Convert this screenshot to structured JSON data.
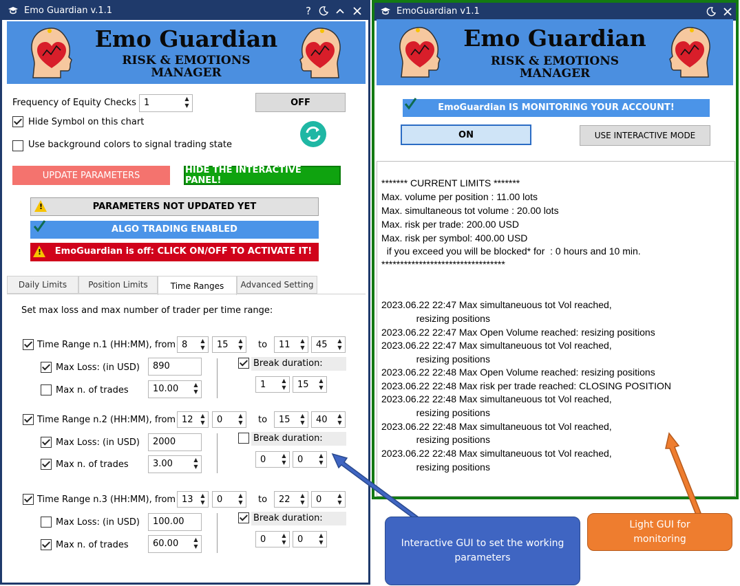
{
  "left_window": {
    "title": "Emo Guardian v.1.1",
    "banner_title": "Emo Guardian",
    "banner_sub1": "RISK & EMOTIONS",
    "banner_sub2": "MANAGER",
    "freq_label": "Frequency of Equity Checks",
    "freq_value": "1",
    "off_button": "OFF",
    "hide_symbol_label": "Hide Symbol on this chart",
    "bg_colors_label": "Use background colors to signal trading state",
    "update_button": "UPDATE PARAMETERS",
    "hide_panel_button": "HIDE THE INTERACTIVE  PANEL!",
    "status_params": "PARAMETERS NOT UPDATED YET",
    "status_algo": "ALGO TRADING ENABLED",
    "status_off": "EmoGuardian is off: CLICK ON/OFF TO ACTIVATE IT!",
    "tabs": [
      "Daily Limits",
      "Position Limits",
      "Time Ranges",
      "Advanced Setting"
    ],
    "section_title": "Set max loss and max number of trader per time range:",
    "ranges": [
      {
        "label": "Time Range n.1 (HH:MM), from",
        "from_h": "8",
        "from_m": "15",
        "to_label": "to",
        "to_h": "11",
        "to_m": "45",
        "loss_label": "Max Loss: (in USD)",
        "loss": "890",
        "trades_label": "Max n. of trades",
        "trades": "10.00",
        "break_label": "Break duration:",
        "break_h": "1",
        "break_m": "15"
      },
      {
        "label": "Time Range n.2 (HH:MM), from",
        "from_h": "12",
        "from_m": "0",
        "to_label": "to",
        "to_h": "15",
        "to_m": "40",
        "loss_label": "Max Loss: (in USD)",
        "loss": "2000",
        "trades_label": "Max n. of trades",
        "trades": "3.00",
        "break_label": "Break duration:",
        "break_h": "0",
        "break_m": "0"
      },
      {
        "label": "Time Range n.3 (HH:MM), from",
        "from_h": "13",
        "from_m": "0",
        "to_label": "to",
        "to_h": "22",
        "to_m": "0",
        "loss_label": "Max Loss: (in USD)",
        "loss": "100.00",
        "trades_label": "Max n. of trades",
        "trades": "60.00",
        "break_label": "Break duration:",
        "break_h": "0",
        "break_m": "0"
      }
    ]
  },
  "right_window": {
    "title": "EmoGuardian v1.1",
    "banner_title": "Emo Guardian",
    "banner_sub1": "RISK & EMOTIONS",
    "banner_sub2": "MANAGER",
    "monitoring": "EmoGuardian IS MONITORING YOUR ACCOUNT!",
    "on_button": "ON",
    "interactive_button": "USE INTERACTIVE MODE",
    "limits_header": "******* CURRENT LIMITS *******",
    "limits": [
      "Max. volume per position : 11.00 lots",
      "Max. simultaneous tot volume : 20.00 lots",
      "Max. risk per trade: 200.00 USD",
      "Max. risk per symbol: 400.00 USD",
      "  if you exceed you will be blocked* for  : 0 hours and 10 min."
    ],
    "limits_footer": "*********************************",
    "log": [
      "2023.06.22 22:47 Max simultaneuous tot Vol reached,",
      "             resizing positions",
      "2023.06.22 22:47 Max Open Volume reached: resizing positions",
      "2023.06.22 22:47 Max simultaneuous tot Vol reached,",
      "             resizing positions",
      "2023.06.22 22:48 Max Open Volume reached: resizing positions",
      "2023.06.22 22:48 Max risk per trade reached: CLOSING POSITION",
      "2023.06.22 22:48 Max simultaneuous tot Vol reached,",
      "             resizing positions",
      "2023.06.22 22:48 Max simultaneuous tot Vol reached,",
      "             resizing positions",
      "2023.06.22 22:48 Max simultaneuous tot Vol reached,",
      "             resizing positions"
    ]
  },
  "callouts": {
    "interactive": "Interactive GUI to set the working parameters",
    "light": "Light GUI for monitoring"
  },
  "colors": {
    "titlebar": "#1f3a6b",
    "banner": "#4b8fe0",
    "update": "#f4736e",
    "hide": "#0fa30f",
    "algo": "#4b94e8",
    "off_status": "#d0021b",
    "callout_blue": "#3f65c2",
    "callout_orange": "#ee7d2f"
  },
  "icons": [
    "graduation-cap-icon",
    "help-icon",
    "moon-icon",
    "chevron-up-icon",
    "close-icon",
    "refresh-icon",
    "warning-icon",
    "check-icon",
    "head-heart-icon"
  ]
}
